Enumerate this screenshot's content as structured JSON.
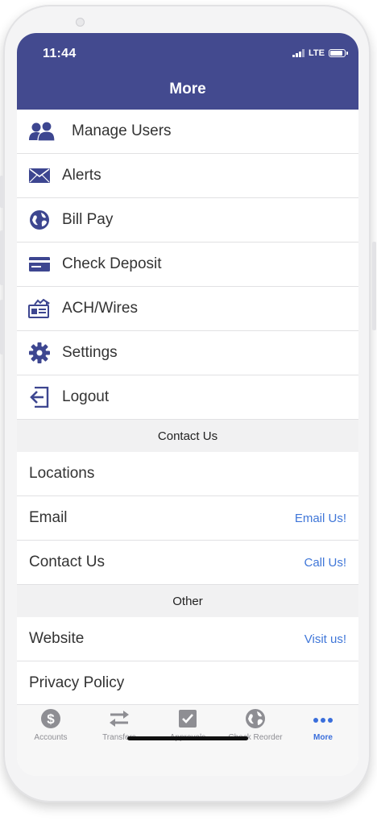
{
  "status_bar": {
    "time": "11:44",
    "network": "LTE"
  },
  "header": {
    "title": "More"
  },
  "menu_items": [
    {
      "label": "Manage Users",
      "icon": "users-icon"
    },
    {
      "label": "Alerts",
      "icon": "envelope-icon"
    },
    {
      "label": "Bill Pay",
      "icon": "globe-icon"
    },
    {
      "label": "Check Deposit",
      "icon": "check-card-icon"
    },
    {
      "label": "ACH/Wires",
      "icon": "ach-wires-icon"
    },
    {
      "label": "Settings",
      "icon": "gear-icon"
    },
    {
      "label": "Logout",
      "icon": "logout-icon"
    }
  ],
  "contact_section": {
    "header": "Contact Us",
    "items": [
      {
        "label": "Locations",
        "action": ""
      },
      {
        "label": "Email",
        "action": "Email Us!"
      },
      {
        "label": "Contact Us",
        "action": "Call Us!"
      }
    ]
  },
  "other_section": {
    "header": "Other",
    "items": [
      {
        "label": "Website",
        "action": "Visit us!"
      },
      {
        "label": "Privacy Policy",
        "action": ""
      }
    ]
  },
  "tab_bar": {
    "tabs": [
      {
        "label": "Accounts",
        "icon": "dollar-coin-icon",
        "active": false
      },
      {
        "label": "Transfers",
        "icon": "transfer-arrows-icon",
        "active": false
      },
      {
        "label": "Approvals",
        "icon": "checkbox-icon",
        "active": false
      },
      {
        "label": "Check Reorder",
        "icon": "globe-icon",
        "active": false
      },
      {
        "label": "More",
        "icon": "more-dots-icon",
        "active": true
      }
    ]
  },
  "colors": {
    "header_bg": "#434a8f",
    "icon": "#3d4690",
    "link": "#3f76d8",
    "tab_active": "#3a6edb",
    "tab_inactive": "#8e8e93"
  }
}
